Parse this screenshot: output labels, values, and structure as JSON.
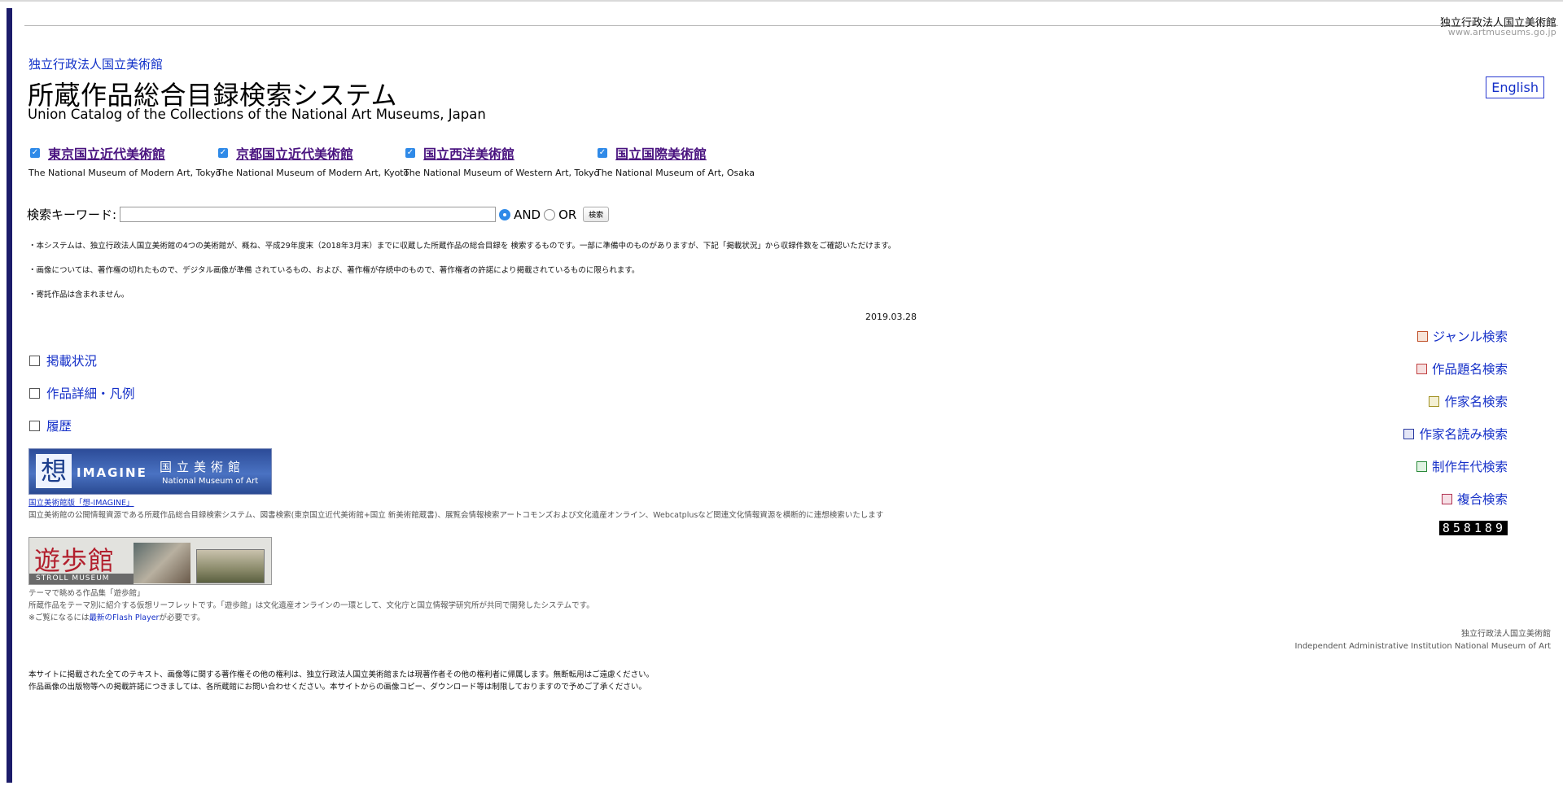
{
  "header": {
    "org_name": "独立行政法人国立美術館",
    "org_url": "www.artmuseums.go.jp",
    "brand": "独立行政法人国立美術館",
    "title": "所蔵作品総合目録検索システム",
    "subtitle": "Union Catalog of the Collections of the National Art Museums, Japan",
    "english_button": "English"
  },
  "museums": [
    {
      "name": "東京国立近代美術館",
      "desc": "The National Museum of Modern Art, Tokyo",
      "checked": true
    },
    {
      "name": "京都国立近代美術館",
      "desc": "The National Museum of Modern Art, Kyoto",
      "checked": true
    },
    {
      "name": "国立西洋美術館",
      "desc": "The National Museum of Western Art, Tokyo",
      "checked": true
    },
    {
      "name": "国立国際美術館",
      "desc": "The National Museum of Art, Osaka",
      "checked": true
    }
  ],
  "search": {
    "label": "検索キーワード:",
    "value": "",
    "and_label": "AND",
    "or_label": "OR",
    "selected": "AND",
    "button": "検索"
  },
  "notes": [
    "・本システムは、独立行政法人国立美術館の4つの美術館が、概ね、平成29年度末（2018年3月末）までに収蔵した所蔵作品の総合目録を 検索するものです。一部に準備中のものがありますが、下記「掲載状況」から収録件数をご確認いただけます。",
    "・画像については、著作権の切れたもので、デジタル画像が準備 されているもの、および、著作権が存続中のもので、著作権者の許諾により掲載されているものに限られます。",
    "・寄託作品は含まれません。"
  ],
  "date": "2019.03.28",
  "left_nav": [
    {
      "label": "掲載状況"
    },
    {
      "label": "作品詳細・凡例"
    },
    {
      "label": "履歴"
    }
  ],
  "right_nav": [
    {
      "label": "ジャンル検索",
      "color": "#c0502a"
    },
    {
      "label": "作品題名検索",
      "color": "#c04040"
    },
    {
      "label": "作家名検索",
      "color": "#a09020"
    },
    {
      "label": "作家名読み検索",
      "color": "#2a3aa0"
    },
    {
      "label": "制作年代検索",
      "color": "#2a8a3a"
    },
    {
      "label": "複合検索",
      "color": "#b03050"
    }
  ],
  "counter": "858189",
  "imagine": {
    "logo_glyph": "想",
    "word": "IMAGINE",
    "jp": "国立美術館",
    "en": "National Museum of Art",
    "link": "国立美術館版「想-IMAGINE」",
    "desc": "国立美術館の公開情報資源である所蔵作品総合目録検索システム、図書検索(東京国立近代美術館+国立 新美術館蔵書)、展覧会情報検索アートコモンズおよび文化遺産オンライン、Webcatplusなど関連文化情報資源を横断的に連想検索いたします"
  },
  "stroll": {
    "jp": "遊歩館",
    "en": "STROLL MUSEUM",
    "caption": "テーマで眺める作品集「遊歩館」",
    "desc": "所蔵作品をテーマ別に紹介する仮想リーフレットです。「遊歩館」は文化遺産オンラインの一環として、文化庁と国立情報学研究所が共同で開発したシステムです。",
    "flash_prefix": "※ご覧になるには",
    "flash_link": "最新のFlash Player",
    "flash_suffix": "が必要です。"
  },
  "footer": {
    "org_jp": "独立行政法人国立美術館",
    "org_en": "Independent Administrative Institution National Museum of Art",
    "copyright_1": "本サイトに掲載された全てのテキスト、画像等に関する著作権その他の権利は、独立行政法人国立美術館または現著作者その他の権利者に帰属します。無断転用はご遠慮ください。",
    "copyright_2": "作品画像の出版物等への掲載許諾につきましては、各所蔵館にお問い合わせください。本サイトからの画像コピー、ダウンロード等は制限しておりますので予めご了承ください。"
  }
}
